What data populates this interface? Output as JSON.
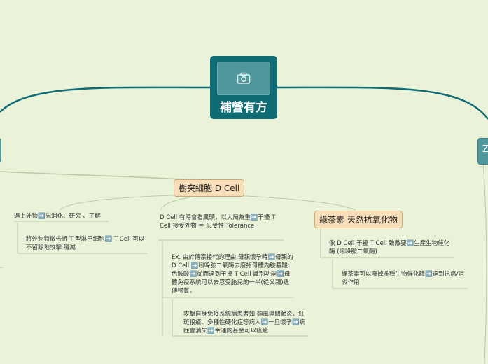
{
  "central": {
    "title": "補營有方",
    "image_icon": "camera-icon"
  },
  "right_stub": {
    "label": "Z"
  },
  "topics": {
    "dendritic": "樹突細胞 D Cell",
    "green_tea": "綠茶素 天然抗氧化物"
  },
  "notes": {
    "n1": "遇上外物➡️先消化、研究 、了解",
    "n2": "將外物特徵告訴 T 型淋巴細胞➡️ T Cell 可以不留餘地攻擊 殲滅",
    "n3": "D Cell 有時會看風頭，以大局為重➡️干擾 T Cell 接受外物 ＝ 忍受性 Tolerance",
    "n4": "Ex. 由於傳宗接代的理由,母親懷孕時➡️母親的D Cell ➡️吲哚胺二氧酶去廢掉母體內胺基酸: 色胺酸➡️從而達到干擾 T Cell 識別功能➡️母體免疫系統可以去忍受胎兒的一半(從父親)遺傳物質。",
    "n5": "攻擊自身免疫系統病患者如 類風濕關節炎、紅斑狼瘡、多種性硬化症等病人➡️一旦懷孕➡️病症會消失➡️幸運的甚至可以痊癒",
    "n6": "像 D Cell 干擾 T Cell 致敵要➡️生產生物催化酶 (吲哚胺二氧酶)",
    "n7": "綠茶素可以廢掉多種生物催化酶➡️達到抗癌/消炎作用"
  },
  "colors": {
    "background": "#eaf3d9",
    "central": "#0f6b74",
    "branch": "#0f6b74",
    "topic_fill": "#f7ddb8",
    "connector": "#b9c9a6"
  }
}
